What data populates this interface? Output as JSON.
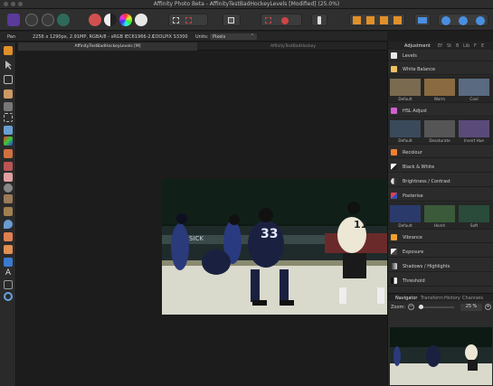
{
  "window": {
    "title": "Affinity Photo Beta - AffinityTestBadHockeyLevels [Modified] (25.0%)"
  },
  "context_bar": {
    "tool": "Pan",
    "doc_info": "2256 x 1290px, 2.91MP, RGBA/8 - sRGB IEC61966-2.1",
    "profile": "COOLPIX S3300",
    "units_label": "Units:",
    "units_value": "Pixels"
  },
  "doc_tabs": [
    {
      "label": "AffinityTestBadHockeyLevels [M]"
    },
    {
      "label": "AffinityTestBadHockey"
    }
  ],
  "panel": {
    "tabs": [
      "Adjustment",
      "Ef",
      "St",
      "B",
      "Lib",
      "F",
      "E"
    ],
    "adjustments": [
      {
        "label": "Levels",
        "color": "#e8e8e8"
      },
      {
        "label": "White Balance",
        "color": "#f0c060"
      },
      {
        "label": "HSL Adjust",
        "color": "#d060d0"
      },
      {
        "label": "Recolour",
        "color": "#f08030"
      },
      {
        "label": "Black & White",
        "color": "#ffffff"
      },
      {
        "label": "Brightness / Contrast",
        "color": "#dddddd"
      },
      {
        "label": "Posterise",
        "color": "#e04050"
      },
      {
        "label": "Vibrance",
        "color": "#f0a030"
      },
      {
        "label": "Exposure",
        "color": "#f0f0f0"
      },
      {
        "label": "Shadows / Highlights",
        "color": "#bbbbbb"
      },
      {
        "label": "Threshold",
        "color": "#999999"
      }
    ],
    "presets": {
      "white_balance": [
        "Default",
        "Warm",
        "Cool"
      ],
      "hsl": [
        "Default",
        "Desaturate",
        "Invert Hue"
      ],
      "posterise": [
        "Default",
        "Harsh",
        "Soft"
      ]
    }
  },
  "navigator": {
    "tabs": [
      "Navigator",
      "Transform",
      "History",
      "Channels"
    ],
    "zoom_label": "Zoom:",
    "zoom_value": "25 %"
  },
  "photo": {
    "jersey_number": "33",
    "jersey_number_right": "11",
    "board_text": "SICK"
  }
}
